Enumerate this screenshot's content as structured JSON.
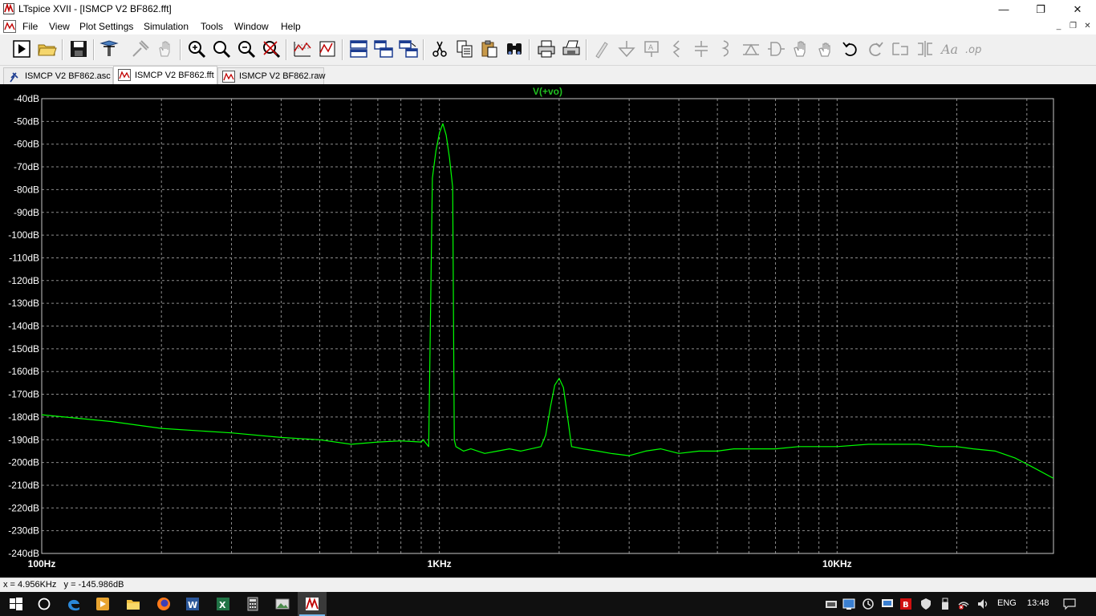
{
  "window": {
    "title": "LTspice XVII - [ISMCP V2 BF862.fft]",
    "minimize_glyph": "—",
    "maximize_glyph": "❐",
    "close_glyph": "✕"
  },
  "menu": {
    "items": [
      "File",
      "View",
      "Plot Settings",
      "Simulation",
      "Tools",
      "Window",
      "Help"
    ],
    "mdi_minimize": "_",
    "mdi_restore": "❐",
    "mdi_close": "✕"
  },
  "tabs": [
    {
      "label": "ISMCP V2 BF862.asc",
      "icon": "schematic-icon",
      "active": false
    },
    {
      "label": "ISMCP V2 BF862.fft",
      "icon": "waveform-icon",
      "active": true
    },
    {
      "label": "ISMCP V2 BF862.raw",
      "icon": "waveform-icon",
      "active": false
    }
  ],
  "colors": {
    "trace": "#00ff00",
    "trace_label": "#20c020",
    "grid": "#8c8c8c",
    "plot_background": "#000000",
    "axis_text": "#ffffff"
  },
  "chart_data": {
    "type": "line",
    "title": "V(+vo)",
    "xlabel": "",
    "ylabel": "",
    "x_scale": "log",
    "xlim": [
      100,
      35000
    ],
    "ylim": [
      -240,
      -40
    ],
    "grid": true,
    "x_ticks": [
      {
        "value": 100,
        "label": "100Hz"
      },
      {
        "value": 1000,
        "label": "1KHz"
      },
      {
        "value": 10000,
        "label": "10KHz"
      }
    ],
    "y_ticks": [
      -40,
      -50,
      -60,
      -70,
      -80,
      -90,
      -100,
      -110,
      -120,
      -130,
      -140,
      -150,
      -160,
      -170,
      -180,
      -190,
      -200,
      -210,
      -220,
      -230,
      -240
    ],
    "y_tick_labels": [
      "-40dB",
      "-50dB",
      "-60dB",
      "-70dB",
      "-80dB",
      "-90dB",
      "-100dB",
      "-110dB",
      "-120dB",
      "-130dB",
      "-140dB",
      "-150dB",
      "-160dB",
      "-170dB",
      "-180dB",
      "-190dB",
      "-200dB",
      "-210dB",
      "-220dB",
      "-230dB",
      "-240dB"
    ],
    "series": [
      {
        "name": "V(+vo)",
        "x": [
          100,
          150,
          200,
          300,
          400,
          500,
          600,
          700,
          800,
          900,
          910,
          920,
          940,
          960,
          980,
          1000,
          1020,
          1040,
          1060,
          1080,
          1090,
          1100,
          1150,
          1200,
          1300,
          1400,
          1500,
          1600,
          1700,
          1800,
          1850,
          1900,
          1950,
          2000,
          2050,
          2100,
          2150,
          2300,
          2500,
          2700,
          3000,
          3300,
          3600,
          4000,
          4500,
          5000,
          5500,
          6000,
          7000,
          8000,
          9000,
          10000,
          12000,
          14000,
          16000,
          18000,
          20000,
          22000,
          25000,
          28000,
          31000,
          35000
        ],
        "y": [
          -179,
          -182,
          -185,
          -187,
          -189,
          -190,
          -192,
          -191,
          -190.5,
          -191,
          -190,
          -191,
          -193,
          -75,
          -63,
          -55,
          -51,
          -56,
          -66,
          -79,
          -190,
          -193,
          -195,
          -194,
          -196,
          -195,
          -194,
          -195,
          -194,
          -193,
          -188,
          -176,
          -166,
          -163,
          -167,
          -180,
          -193,
          -194,
          -195,
          -196,
          -197,
          -195,
          -194,
          -196,
          -195,
          -195,
          -194,
          -194,
          -194,
          -193,
          -193,
          -193,
          -192,
          -192,
          -192,
          -193,
          -193,
          -194,
          -195,
          -198,
          -202,
          -207
        ]
      }
    ]
  },
  "status": {
    "cursor_readout": "x = 4.956KHz   y = -145.986dB"
  },
  "taskbar": {
    "language": "ENG",
    "clock": "13:48"
  }
}
